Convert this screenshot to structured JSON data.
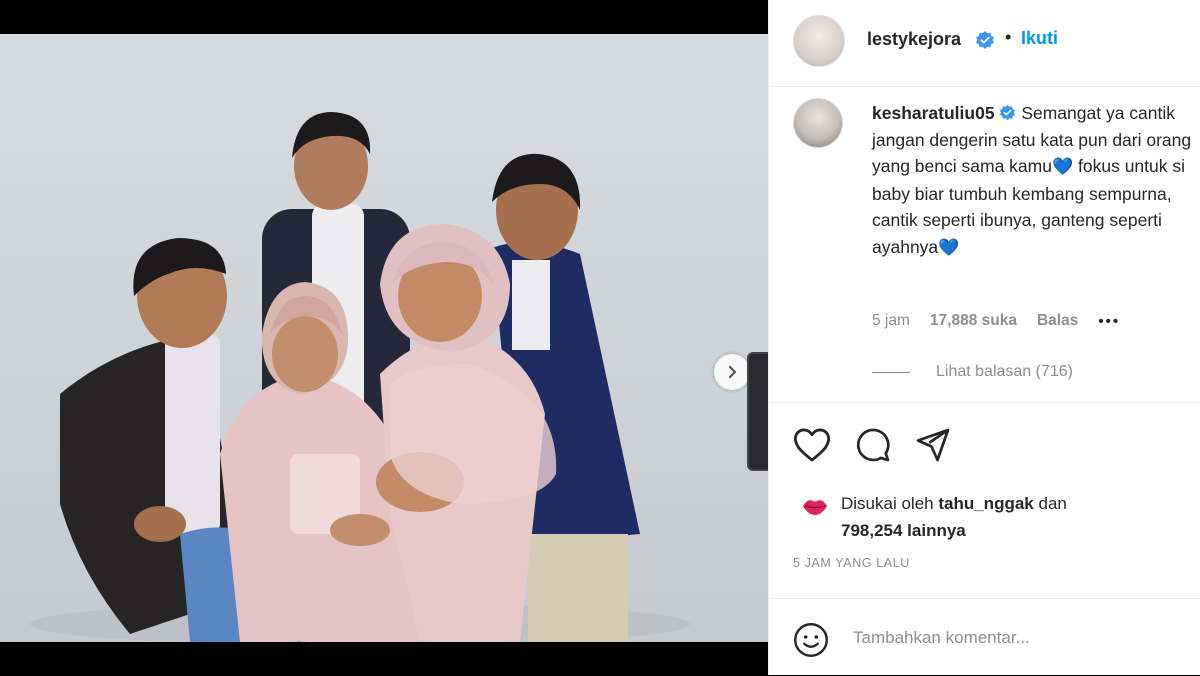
{
  "post": {
    "owner_username": "lestykejora",
    "separator": "•",
    "follow_label": "Ikuti"
  },
  "comment": {
    "username": "kesharatuliu05",
    "text_1": "Semangat ya cantik jangan dengerin satu kata pun dari orang yang benci sama kamu",
    "heart_1": "💙",
    "text_2": " fokus untuk si baby biar tumbuh kembang sempurna, cantik seperti ibunya, ganteng seperti ayahnya",
    "heart_2": "💙",
    "time": "5 jam",
    "likes": "17,888 suka",
    "reply_label": "Balas",
    "more_label": "•••",
    "view_replies": "Lihat balasan (716)"
  },
  "likes": {
    "prefix": "Disukai oleh",
    "user": "tahu_nggak",
    "conj": "dan",
    "others": "798,254 lainnya"
  },
  "timestamp": "5 JAM YANG LALU",
  "add_comment": {
    "placeholder": "Tambahkan komentar..."
  },
  "colors": {
    "link_blue": "#0095f6",
    "verified_blue": "#3897f0",
    "text": "#262626",
    "muted": "#8e8e8e"
  },
  "icons": [
    "verified-badge-icon",
    "heart-icon",
    "comment-icon",
    "share-icon",
    "emoji-icon",
    "chevron-right-icon",
    "lips-icon"
  ]
}
